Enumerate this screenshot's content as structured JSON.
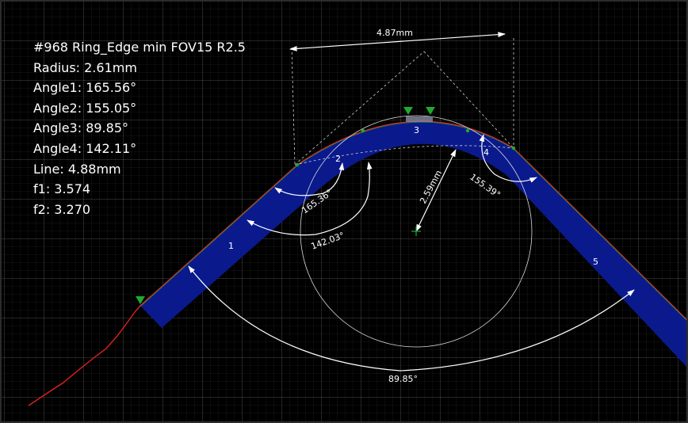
{
  "measurement": {
    "title": "#968 Ring_Edge min FOV15 R2.5",
    "radius": "Radius: 2.61mm",
    "angle1": "Angle1: 165.56°",
    "angle2": "Angle2: 155.05°",
    "angle3": "Angle3: 89.85°",
    "angle4": "Angle4: 142.11°",
    "line": "Line: 4.88mm",
    "f1": "f1: 3.574",
    "f2": "f2: 3.270"
  },
  "segments": [
    "1",
    "2",
    "3",
    "4",
    "5"
  ],
  "annotations": {
    "top_distance": "4.87mm",
    "radius_dim": "2.59mm",
    "angle_a": "165.36°",
    "angle_b": "142.03°",
    "angle_c": "155.39°",
    "angle_d": "89.85°"
  },
  "colors": {
    "background": "#000000",
    "profile_fill": "#0a1a8c",
    "edge_line": "#e02020",
    "marker": "#1faa2e",
    "dimension": "#ffffff"
  }
}
